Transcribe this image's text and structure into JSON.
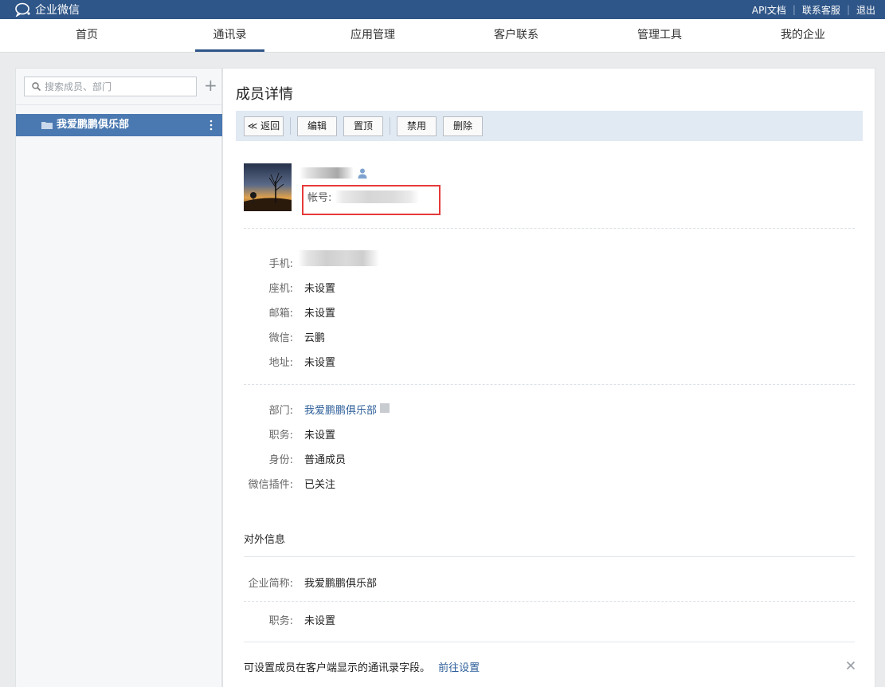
{
  "app": {
    "name": "企业微信"
  },
  "top_links": {
    "api": "API文档",
    "service": "联系客服",
    "logout": "退出",
    "sep": "|"
  },
  "nav": {
    "home": "首页",
    "contacts": "通讯录",
    "apps": "应用管理",
    "customers": "客户联系",
    "tools": "管理工具",
    "company": "我的企业"
  },
  "sidebar": {
    "search_placeholder": "搜索成员、部门",
    "add_symbol": "+",
    "department": "我爱鹏鹏俱乐部"
  },
  "detail": {
    "title": "成员详情",
    "toolbar": {
      "back": "≪ 返回",
      "edit": "编辑",
      "pin": "置顶",
      "disable": "禁用",
      "delete": "删除"
    },
    "account_label": "帐号:",
    "fields": {
      "phone_label": "手机:",
      "landline_label": "座机:",
      "landline_value": "未设置",
      "email_label": "邮箱:",
      "email_value": "未设置",
      "wechat_label": "微信:",
      "wechat_value": "云鹏",
      "address_label": "地址:",
      "address_value": "未设置",
      "dept_label": "部门:",
      "dept_value": "我爱鹏鹏俱乐部",
      "position_label": "职务:",
      "position_value": "未设置",
      "identity_label": "身份:",
      "identity_value": "普通成员",
      "plugin_label": "微信插件:",
      "plugin_value": "已关注"
    },
    "external": {
      "title": "对外信息",
      "corp_label": "企业简称:",
      "corp_value": "我爱鹏鹏俱乐部",
      "position_label": "职务:",
      "position_value": "未设置"
    },
    "footer": {
      "note": "可设置成员在客户端显示的通讯录字段。",
      "link": "前往设置"
    }
  },
  "colors": {
    "brand": "#2f5688",
    "selected": "#4a78b0",
    "highlight_box": "#e63a3a",
    "link": "#2e5f9a"
  }
}
